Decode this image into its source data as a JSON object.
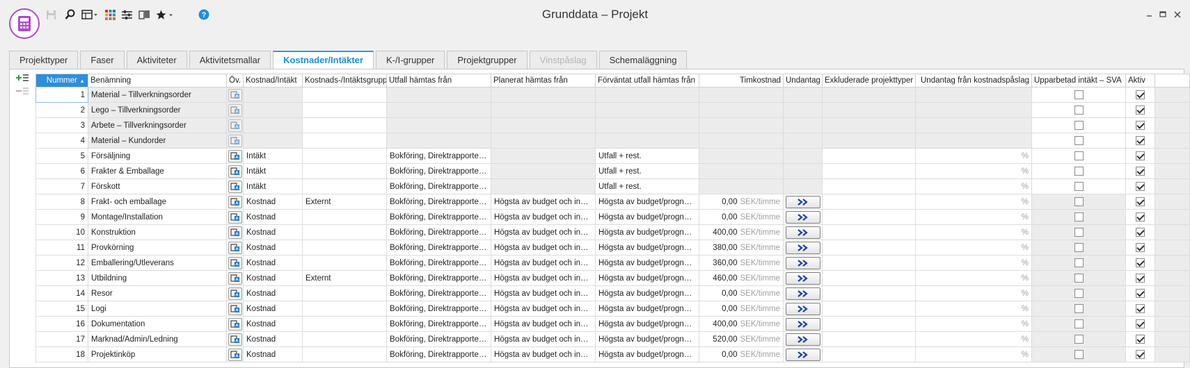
{
  "window": {
    "title": "Grunddata – Projekt"
  },
  "tabs": [
    {
      "label": "Projekttyper",
      "state": "normal"
    },
    {
      "label": "Faser",
      "state": "normal"
    },
    {
      "label": "Aktiviteter",
      "state": "normal"
    },
    {
      "label": "Aktivitetsmallar",
      "state": "normal"
    },
    {
      "label": "Kostnader/Intäkter",
      "state": "active"
    },
    {
      "label": "K-/I-grupper",
      "state": "normal"
    },
    {
      "label": "Projektgrupper",
      "state": "normal"
    },
    {
      "label": "Vinstpåslag",
      "state": "disabled"
    },
    {
      "label": "Schemaläggning",
      "state": "normal"
    }
  ],
  "grid": {
    "columns": {
      "nummer": "Nummer",
      "benamning": "Benämning",
      "ov": "Öv.",
      "kostnad_intakt": "Kostnad/Intäkt",
      "grupp": "Kostnads-/Intäktsgrupp",
      "utfall": "Utfall hämtas från",
      "planerat": "Planerat hämtas från",
      "forvantat": "Förväntat utfall hämtas från",
      "timkostnad": "Timkostnad",
      "undantag": "Undantag",
      "exkluderade": "Exkluderade projekttyper",
      "undantag_paslag": "Undantag från kostnadspåslag",
      "upparbetad": "Upparbetad intäkt – SVA",
      "aktiv": "Aktiv"
    },
    "unit_label": "SEK/timme",
    "pct_label": "%",
    "rows": [
      {
        "nummer": "1",
        "benamning": "Material – Tillverkningsorder",
        "type": "",
        "grupp": "",
        "utfall": "",
        "planerat": "",
        "forvantat": "",
        "timkostnad": "",
        "kind": "locked",
        "upparbetad": false,
        "aktiv": true
      },
      {
        "nummer": "2",
        "benamning": "Lego – Tillverkningsorder",
        "type": "",
        "grupp": "",
        "utfall": "",
        "planerat": "",
        "forvantat": "",
        "timkostnad": "",
        "kind": "locked",
        "upparbetad": false,
        "aktiv": true
      },
      {
        "nummer": "3",
        "benamning": "Arbete – Tillverkningsorder",
        "type": "",
        "grupp": "",
        "utfall": "",
        "planerat": "",
        "forvantat": "",
        "timkostnad": "",
        "kind": "locked",
        "upparbetad": false,
        "aktiv": true
      },
      {
        "nummer": "4",
        "benamning": "Material – Kundorder",
        "type": "",
        "grupp": "",
        "utfall": "",
        "planerat": "",
        "forvantat": "",
        "timkostnad": "",
        "kind": "locked",
        "upparbetad": false,
        "aktiv": true
      },
      {
        "nummer": "5",
        "benamning": "Försäljning",
        "type": "Intäkt",
        "grupp": "",
        "utfall": "Bokföring, Direktrapportering",
        "planerat": "",
        "forvantat": "Utfall + rest.",
        "timkostnad": "",
        "kind": "income",
        "upparbetad": false,
        "aktiv": true
      },
      {
        "nummer": "6",
        "benamning": "Frakter & Emballage",
        "type": "Intäkt",
        "grupp": "",
        "utfall": "Bokföring, Direktrapportering",
        "planerat": "",
        "forvantat": "Utfall + rest.",
        "timkostnad": "",
        "kind": "income",
        "upparbetad": false,
        "aktiv": true
      },
      {
        "nummer": "7",
        "benamning": "Förskott",
        "type": "Intäkt",
        "grupp": "",
        "utfall": "Bokföring, Direktrapportering",
        "planerat": "",
        "forvantat": "Utfall + rest.",
        "timkostnad": "",
        "kind": "income",
        "upparbetad": false,
        "aktiv": true
      },
      {
        "nummer": "8",
        "benamning": "Frakt- och emballage",
        "type": "Kostnad",
        "grupp": "Externt",
        "utfall": "Bokföring, Direktrapportering",
        "planerat": "Högsta av budget och inkö...",
        "forvantat": "Högsta av budget/prognos...",
        "timkostnad": "0,00",
        "kind": "cost",
        "upparbetad": false,
        "aktiv": true
      },
      {
        "nummer": "9",
        "benamning": "Montage/Installation",
        "type": "Kostnad",
        "grupp": "",
        "utfall": "Bokföring, Direktrapportering",
        "planerat": "Högsta av budget och inkö...",
        "forvantat": "Högsta av budget/prognos...",
        "timkostnad": "0,00",
        "kind": "cost",
        "upparbetad": false,
        "aktiv": true
      },
      {
        "nummer": "10",
        "benamning": "Konstruktion",
        "type": "Kostnad",
        "grupp": "",
        "utfall": "Bokföring, Direktrapportering",
        "planerat": "Högsta av budget och inkö...",
        "forvantat": "Högsta av budget/prognos...",
        "timkostnad": "400,00",
        "kind": "cost",
        "upparbetad": false,
        "aktiv": true
      },
      {
        "nummer": "11",
        "benamning": "Provkörning",
        "type": "Kostnad",
        "grupp": "",
        "utfall": "Bokföring, Direktrapportering",
        "planerat": "Högsta av budget och inkö...",
        "forvantat": "Högsta av budget/prognos...",
        "timkostnad": "380,00",
        "kind": "cost",
        "upparbetad": false,
        "aktiv": true
      },
      {
        "nummer": "12",
        "benamning": "Emballering/Utleverans",
        "type": "Kostnad",
        "grupp": "",
        "utfall": "Bokföring, Direktrapportering",
        "planerat": "Högsta av budget och inkö...",
        "forvantat": "Högsta av budget/prognos...",
        "timkostnad": "360,00",
        "kind": "cost",
        "upparbetad": false,
        "aktiv": true
      },
      {
        "nummer": "13",
        "benamning": "Utbildning",
        "type": "Kostnad",
        "grupp": "Externt",
        "utfall": "Bokföring, Direktrapportering",
        "planerat": "Högsta av budget och inkö...",
        "forvantat": "Högsta av budget/prognos...",
        "timkostnad": "460,00",
        "kind": "cost",
        "upparbetad": false,
        "aktiv": true
      },
      {
        "nummer": "14",
        "benamning": "Resor",
        "type": "Kostnad",
        "grupp": "",
        "utfall": "Bokföring, Direktrapportering",
        "planerat": "Högsta av budget och inkö...",
        "forvantat": "Högsta av budget/prognos...",
        "timkostnad": "0,00",
        "kind": "cost",
        "upparbetad": false,
        "aktiv": true
      },
      {
        "nummer": "15",
        "benamning": "Logi",
        "type": "Kostnad",
        "grupp": "",
        "utfall": "Bokföring, Direktrapportering",
        "planerat": "Högsta av budget och inkö...",
        "forvantat": "Högsta av budget/prognos...",
        "timkostnad": "0,00",
        "kind": "cost",
        "upparbetad": false,
        "aktiv": true
      },
      {
        "nummer": "16",
        "benamning": "Dokumentation",
        "type": "Kostnad",
        "grupp": "",
        "utfall": "Bokföring, Direktrapportering",
        "planerat": "Högsta av budget och inkö...",
        "forvantat": "Högsta av budget/prognos...",
        "timkostnad": "400,00",
        "kind": "cost",
        "upparbetad": false,
        "aktiv": true
      },
      {
        "nummer": "17",
        "benamning": "Marknad/Admin/Ledning",
        "type": "Kostnad",
        "grupp": "",
        "utfall": "Bokföring, Direktrapportering",
        "planerat": "Högsta av budget och inkö...",
        "forvantat": "Högsta av budget/prognos...",
        "timkostnad": "520,00",
        "kind": "cost",
        "upparbetad": false,
        "aktiv": true
      },
      {
        "nummer": "18",
        "benamning": "Projektinköp",
        "type": "Kostnad",
        "grupp": "",
        "utfall": "Bokföring, Direktrapportering",
        "planerat": "Högsta av budget och inkö...",
        "forvantat": "Högsta av budget/prognos...",
        "timkostnad": "0,00",
        "kind": "cost",
        "upparbetad": false,
        "aktiv": true
      }
    ]
  },
  "colors": {
    "accent": "#2b8fdc",
    "brand": "#b048c8",
    "gray_cell": "#ececec"
  },
  "icons": {
    "app": "calculator-icon",
    "toolbar": [
      "save-icon",
      "search-icon",
      "view-dropdown-icon",
      "color-grid-icon",
      "settings-sliders-icon",
      "book-icon",
      "favorites-star-icon",
      "help-icon"
    ],
    "sidebar": [
      "add-row-icon",
      "remove-row-icon"
    ],
    "row": [
      "override-icon",
      "exception-arrow-icon"
    ]
  }
}
